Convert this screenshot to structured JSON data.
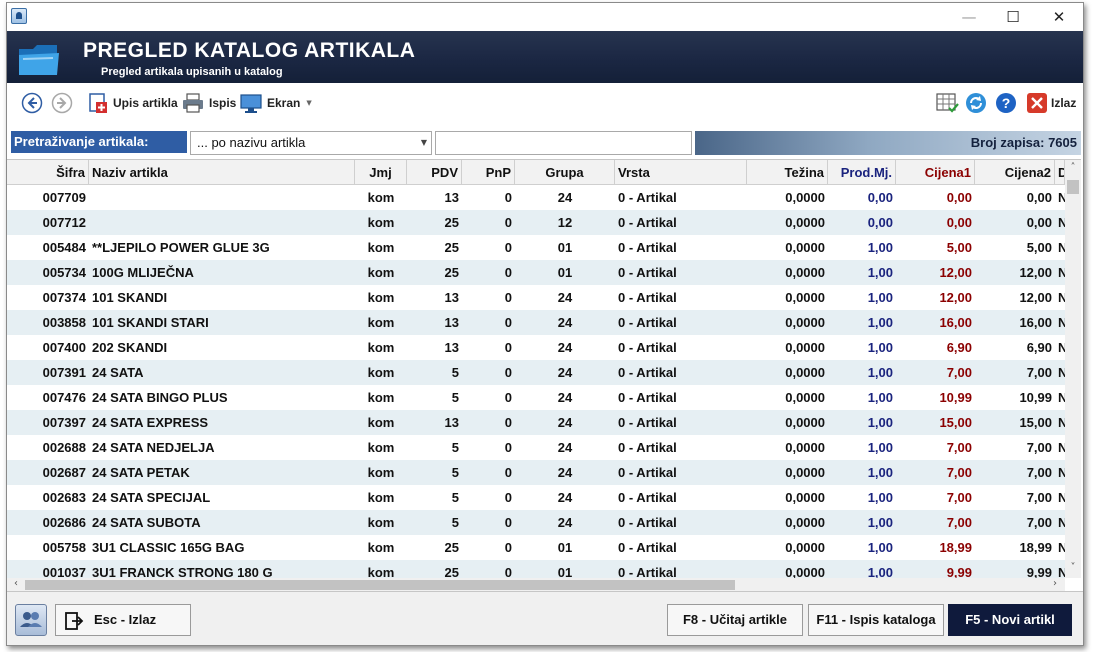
{
  "header": {
    "title": "PREGLED KATALOG ARTIKALA",
    "subtitle": "Pregled artikala upisanih u katalog"
  },
  "toolbar": {
    "add_label": "Upis artikla",
    "print_label": "Ispis",
    "screen_label": "Ekran",
    "exit_label": "Izlaz"
  },
  "search": {
    "label": "Pretraživanje artikala:",
    "mode": "... po nazivu artikla",
    "query": "",
    "count_label": "Broj zapisa: 7605"
  },
  "columns": [
    "Šifra",
    "Naziv artikla",
    "Jmj",
    "PDV",
    "PnP",
    "Grupa",
    "Vrsta",
    "Težina",
    "Prod.Mj.",
    "Cijena1",
    "Cijena2",
    "D"
  ],
  "rows": [
    [
      "007709",
      "",
      "kom",
      "13",
      "0",
      "24",
      "0 - Artikal",
      "0,0000",
      "0,00",
      "0,00",
      "0,00",
      "N"
    ],
    [
      "007712",
      "",
      "kom",
      "25",
      "0",
      "12",
      "0 - Artikal",
      "0,0000",
      "0,00",
      "0,00",
      "0,00",
      "N"
    ],
    [
      "005484",
      "**LJEPILO POWER GLUE 3G",
      "kom",
      "25",
      "0",
      "01",
      "0 - Artikal",
      "0,0000",
      "1,00",
      "5,00",
      "5,00",
      "N"
    ],
    [
      "005734",
      "100G MLIJEČNA",
      "kom",
      "25",
      "0",
      "01",
      "0 - Artikal",
      "0,0000",
      "1,00",
      "12,00",
      "12,00",
      "N"
    ],
    [
      "007374",
      "101 SKANDI",
      "kom",
      "13",
      "0",
      "24",
      "0 - Artikal",
      "0,0000",
      "1,00",
      "12,00",
      "12,00",
      "N"
    ],
    [
      "003858",
      "101 SKANDI STARI",
      "kom",
      "13",
      "0",
      "24",
      "0 - Artikal",
      "0,0000",
      "1,00",
      "16,00",
      "16,00",
      "N"
    ],
    [
      "007400",
      "202 SKANDI",
      "kom",
      "13",
      "0",
      "24",
      "0 - Artikal",
      "0,0000",
      "1,00",
      "6,90",
      "6,90",
      "N"
    ],
    [
      "007391",
      "24 SATA",
      "kom",
      "5",
      "0",
      "24",
      "0 - Artikal",
      "0,0000",
      "1,00",
      "7,00",
      "7,00",
      "N"
    ],
    [
      "007476",
      "24 SATA BINGO PLUS",
      "kom",
      "5",
      "0",
      "24",
      "0 - Artikal",
      "0,0000",
      "1,00",
      "10,99",
      "10,99",
      "N"
    ],
    [
      "007397",
      "24 SATA EXPRESS",
      "kom",
      "13",
      "0",
      "24",
      "0 - Artikal",
      "0,0000",
      "1,00",
      "15,00",
      "15,00",
      "N"
    ],
    [
      "002688",
      "24 SATA NEDJELJA",
      "kom",
      "5",
      "0",
      "24",
      "0 - Artikal",
      "0,0000",
      "1,00",
      "7,00",
      "7,00",
      "N"
    ],
    [
      "002687",
      "24 SATA PETAK",
      "kom",
      "5",
      "0",
      "24",
      "0 - Artikal",
      "0,0000",
      "1,00",
      "7,00",
      "7,00",
      "N"
    ],
    [
      "002683",
      "24 SATA SPECIJAL",
      "kom",
      "5",
      "0",
      "24",
      "0 - Artikal",
      "0,0000",
      "1,00",
      "7,00",
      "7,00",
      "N"
    ],
    [
      "002686",
      "24 SATA SUBOTA",
      "kom",
      "5",
      "0",
      "24",
      "0 - Artikal",
      "0,0000",
      "1,00",
      "7,00",
      "7,00",
      "N"
    ],
    [
      "005758",
      "3U1 CLASSIC 165G BAG",
      "kom",
      "25",
      "0",
      "01",
      "0 - Artikal",
      "0,0000",
      "1,00",
      "18,99",
      "18,99",
      "N"
    ],
    [
      "001037",
      "3U1 FRANCK STRONG 180 G",
      "kom",
      "25",
      "0",
      "01",
      "0 - Artikal",
      "0,0000",
      "1,00",
      "9,99",
      "9,99",
      "N"
    ]
  ],
  "footer": {
    "esc_label": "Esc - Izlaz",
    "f8_label": "F8 - Učitaj artikle",
    "f11_label": "F11 - Ispis kataloga",
    "f5_label": "F5 - Novi artikl"
  },
  "colors": {
    "header_bg": "#1b2743",
    "search_label_bg": "#2f5da4",
    "row_alt": "#e6eff3",
    "prod_color": "#1a237e",
    "price_color": "#8b0000",
    "primary_button": "#0f1a3c"
  },
  "icons": {
    "back": "arrow-left-icon",
    "forward": "arrow-right-icon",
    "add": "add-document-icon",
    "print": "printer-icon",
    "screen": "monitor-icon",
    "table_settings": "table-check-icon",
    "refresh": "refresh-icon",
    "help": "help-icon",
    "exit": "close-icon"
  }
}
